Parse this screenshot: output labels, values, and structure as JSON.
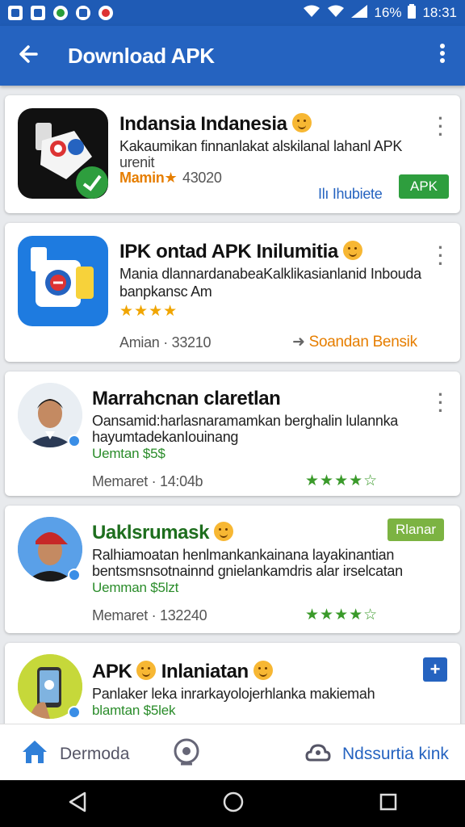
{
  "status_bar": {
    "battery": "16%",
    "time": "18:31"
  },
  "app_bar": {
    "title": "Download APK"
  },
  "cards": [
    {
      "title": "Indansia Indanesia",
      "desc1": "Kakaumikan finnanlakat alskilanal lahanl APK",
      "desc2": "urenit",
      "rating_text": "Mamin★",
      "count": "43020",
      "link": "Ihubiete",
      "button": "APK"
    },
    {
      "title": "IPK ontad APK Inilumitia",
      "desc1": "Mania dlannardanabeaKalklikasianlanid Inbouda",
      "desc2": "banpkansc Am",
      "stars": "★★★★",
      "meta": "Amian · 33210",
      "action": "Soandan Bensik"
    },
    {
      "title": "Marrahcnan claretlan",
      "desc1": "Oansamid:harlasnaramamkan berghalin lulannka",
      "desc2": "hayumtadekanIouinang",
      "price": "Uemtan $5$",
      "meta": "Memaret · 14:04b",
      "stars": "★★★★☆"
    },
    {
      "title": "Uaklsrumask",
      "badge": "Rlanar",
      "desc1": "Ralhiamoatan henlmankankainana layakinantian",
      "desc2": "bentsmsnsotnainnd gnielankamdris alar irselcatan",
      "price": "Uemman $5lzt",
      "meta": "Memaret · 132240",
      "stars": "★★★★☆"
    },
    {
      "title": "APK",
      "title2": "Inlaniatan",
      "desc1": "Panlaker leka inrarkayolojerhlanka makiemah",
      "price": "blamtan $5lek"
    }
  ],
  "bottom_nav": {
    "home_label": "Dermoda",
    "right_label": "Ndssurtia kink"
  },
  "colors": {
    "primary": "#2563c0",
    "green": "#2e9e3e",
    "star": "#f0a500"
  }
}
